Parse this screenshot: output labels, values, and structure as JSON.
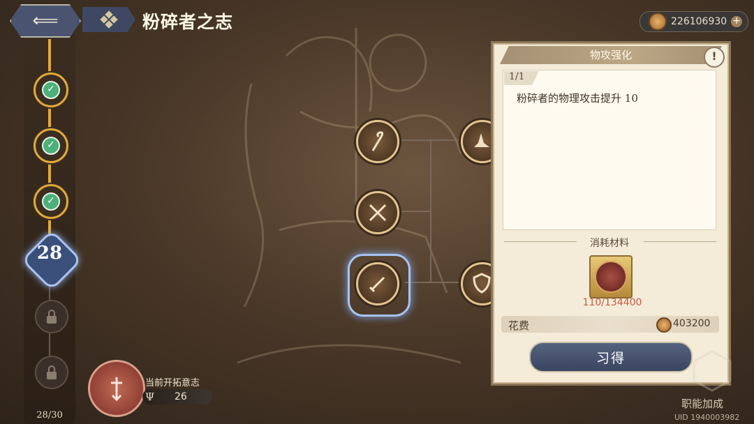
{
  "header": {
    "title": "粉碎者之志",
    "back_icon": "back-arrow-icon",
    "menu_icon": "grid-icon"
  },
  "currency": {
    "amount": "226106930",
    "plus": "+"
  },
  "track": {
    "current_level": "28",
    "progress": "28/30",
    "nodes": [
      {
        "state": "completed"
      },
      {
        "state": "completed"
      },
      {
        "state": "completed"
      },
      {
        "state": "current"
      },
      {
        "state": "locked"
      },
      {
        "state": "locked"
      }
    ]
  },
  "skill_tree": {
    "skills": [
      {
        "icon": "crook-staff-icon"
      },
      {
        "icon": "wizard-hat-icon"
      },
      {
        "icon": "crossed-swords-icon"
      },
      {
        "icon": "sword-icon",
        "selected": true
      },
      {
        "icon": "shield-icon"
      }
    ]
  },
  "pioneer": {
    "label": "当前开拓意志",
    "value": "26"
  },
  "panel": {
    "title": "物攻强化",
    "info": "!",
    "level": "1/1",
    "description": "粉碎者的物理攻击提升 10",
    "materials_label": "消耗材料",
    "material_count": "110/134400",
    "cost_label": "花费",
    "cost_value": "403200",
    "learn_button": "习得"
  },
  "footer": {
    "job_bonus": "职能加成",
    "uid": "UID 1940003982"
  },
  "colors": {
    "accent_gold": "#e2a93a",
    "selected_blue": "#a7c4f2",
    "material_count_red": "#c45a45",
    "button_slate": "#3a4560"
  }
}
